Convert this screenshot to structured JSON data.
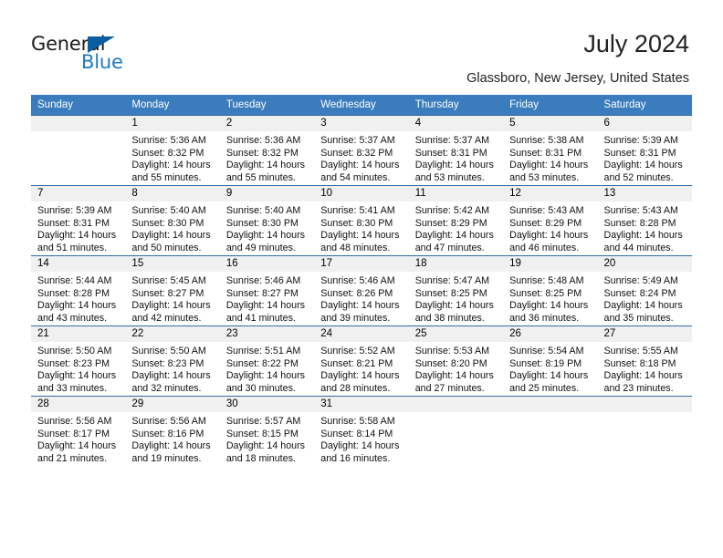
{
  "brand": {
    "name_part1": "General",
    "name_part2": "Blue",
    "triangle_color": "#0a5fa0",
    "blue_color": "#1f7bc1"
  },
  "header": {
    "title": "July 2024",
    "subtitle": "Glassboro, New Jersey, United States"
  },
  "theme": {
    "header_bg": "#3a7cbd",
    "row_divider": "#2f6ea5",
    "daynum_band": "#f0f0f0",
    "cell_bg": "#ffffff"
  },
  "calendar": {
    "weekday_headers": [
      "Sunday",
      "Monday",
      "Tuesday",
      "Wednesday",
      "Thursday",
      "Friday",
      "Saturday"
    ],
    "labels": {
      "sunrise": "Sunrise:",
      "sunset": "Sunset:",
      "daylight": "Daylight:"
    },
    "weeks": [
      [
        {
          "day": "",
          "blank": true
        },
        {
          "day": "1",
          "sunrise": "Sunrise: 5:36 AM",
          "sunset": "Sunset: 8:32 PM",
          "daylight": "Daylight: 14 hours and 55 minutes."
        },
        {
          "day": "2",
          "sunrise": "Sunrise: 5:36 AM",
          "sunset": "Sunset: 8:32 PM",
          "daylight": "Daylight: 14 hours and 55 minutes."
        },
        {
          "day": "3",
          "sunrise": "Sunrise: 5:37 AM",
          "sunset": "Sunset: 8:32 PM",
          "daylight": "Daylight: 14 hours and 54 minutes."
        },
        {
          "day": "4",
          "sunrise": "Sunrise: 5:37 AM",
          "sunset": "Sunset: 8:31 PM",
          "daylight": "Daylight: 14 hours and 53 minutes."
        },
        {
          "day": "5",
          "sunrise": "Sunrise: 5:38 AM",
          "sunset": "Sunset: 8:31 PM",
          "daylight": "Daylight: 14 hours and 53 minutes."
        },
        {
          "day": "6",
          "sunrise": "Sunrise: 5:39 AM",
          "sunset": "Sunset: 8:31 PM",
          "daylight": "Daylight: 14 hours and 52 minutes."
        }
      ],
      [
        {
          "day": "7",
          "sunrise": "Sunrise: 5:39 AM",
          "sunset": "Sunset: 8:31 PM",
          "daylight": "Daylight: 14 hours and 51 minutes."
        },
        {
          "day": "8",
          "sunrise": "Sunrise: 5:40 AM",
          "sunset": "Sunset: 8:30 PM",
          "daylight": "Daylight: 14 hours and 50 minutes."
        },
        {
          "day": "9",
          "sunrise": "Sunrise: 5:40 AM",
          "sunset": "Sunset: 8:30 PM",
          "daylight": "Daylight: 14 hours and 49 minutes."
        },
        {
          "day": "10",
          "sunrise": "Sunrise: 5:41 AM",
          "sunset": "Sunset: 8:30 PM",
          "daylight": "Daylight: 14 hours and 48 minutes."
        },
        {
          "day": "11",
          "sunrise": "Sunrise: 5:42 AM",
          "sunset": "Sunset: 8:29 PM",
          "daylight": "Daylight: 14 hours and 47 minutes."
        },
        {
          "day": "12",
          "sunrise": "Sunrise: 5:43 AM",
          "sunset": "Sunset: 8:29 PM",
          "daylight": "Daylight: 14 hours and 46 minutes."
        },
        {
          "day": "13",
          "sunrise": "Sunrise: 5:43 AM",
          "sunset": "Sunset: 8:28 PM",
          "daylight": "Daylight: 14 hours and 44 minutes."
        }
      ],
      [
        {
          "day": "14",
          "sunrise": "Sunrise: 5:44 AM",
          "sunset": "Sunset: 8:28 PM",
          "daylight": "Daylight: 14 hours and 43 minutes."
        },
        {
          "day": "15",
          "sunrise": "Sunrise: 5:45 AM",
          "sunset": "Sunset: 8:27 PM",
          "daylight": "Daylight: 14 hours and 42 minutes."
        },
        {
          "day": "16",
          "sunrise": "Sunrise: 5:46 AM",
          "sunset": "Sunset: 8:27 PM",
          "daylight": "Daylight: 14 hours and 41 minutes."
        },
        {
          "day": "17",
          "sunrise": "Sunrise: 5:46 AM",
          "sunset": "Sunset: 8:26 PM",
          "daylight": "Daylight: 14 hours and 39 minutes."
        },
        {
          "day": "18",
          "sunrise": "Sunrise: 5:47 AM",
          "sunset": "Sunset: 8:25 PM",
          "daylight": "Daylight: 14 hours and 38 minutes."
        },
        {
          "day": "19",
          "sunrise": "Sunrise: 5:48 AM",
          "sunset": "Sunset: 8:25 PM",
          "daylight": "Daylight: 14 hours and 36 minutes."
        },
        {
          "day": "20",
          "sunrise": "Sunrise: 5:49 AM",
          "sunset": "Sunset: 8:24 PM",
          "daylight": "Daylight: 14 hours and 35 minutes."
        }
      ],
      [
        {
          "day": "21",
          "sunrise": "Sunrise: 5:50 AM",
          "sunset": "Sunset: 8:23 PM",
          "daylight": "Daylight: 14 hours and 33 minutes."
        },
        {
          "day": "22",
          "sunrise": "Sunrise: 5:50 AM",
          "sunset": "Sunset: 8:23 PM",
          "daylight": "Daylight: 14 hours and 32 minutes."
        },
        {
          "day": "23",
          "sunrise": "Sunrise: 5:51 AM",
          "sunset": "Sunset: 8:22 PM",
          "daylight": "Daylight: 14 hours and 30 minutes."
        },
        {
          "day": "24",
          "sunrise": "Sunrise: 5:52 AM",
          "sunset": "Sunset: 8:21 PM",
          "daylight": "Daylight: 14 hours and 28 minutes."
        },
        {
          "day": "25",
          "sunrise": "Sunrise: 5:53 AM",
          "sunset": "Sunset: 8:20 PM",
          "daylight": "Daylight: 14 hours and 27 minutes."
        },
        {
          "day": "26",
          "sunrise": "Sunrise: 5:54 AM",
          "sunset": "Sunset: 8:19 PM",
          "daylight": "Daylight: 14 hours and 25 minutes."
        },
        {
          "day": "27",
          "sunrise": "Sunrise: 5:55 AM",
          "sunset": "Sunset: 8:18 PM",
          "daylight": "Daylight: 14 hours and 23 minutes."
        }
      ],
      [
        {
          "day": "28",
          "sunrise": "Sunrise: 5:56 AM",
          "sunset": "Sunset: 8:17 PM",
          "daylight": "Daylight: 14 hours and 21 minutes."
        },
        {
          "day": "29",
          "sunrise": "Sunrise: 5:56 AM",
          "sunset": "Sunset: 8:16 PM",
          "daylight": "Daylight: 14 hours and 19 minutes."
        },
        {
          "day": "30",
          "sunrise": "Sunrise: 5:57 AM",
          "sunset": "Sunset: 8:15 PM",
          "daylight": "Daylight: 14 hours and 18 minutes."
        },
        {
          "day": "31",
          "sunrise": "Sunrise: 5:58 AM",
          "sunset": "Sunset: 8:14 PM",
          "daylight": "Daylight: 14 hours and 16 minutes."
        },
        {
          "day": "",
          "blank": true
        },
        {
          "day": "",
          "blank": true
        },
        {
          "day": "",
          "blank": true
        }
      ]
    ]
  }
}
